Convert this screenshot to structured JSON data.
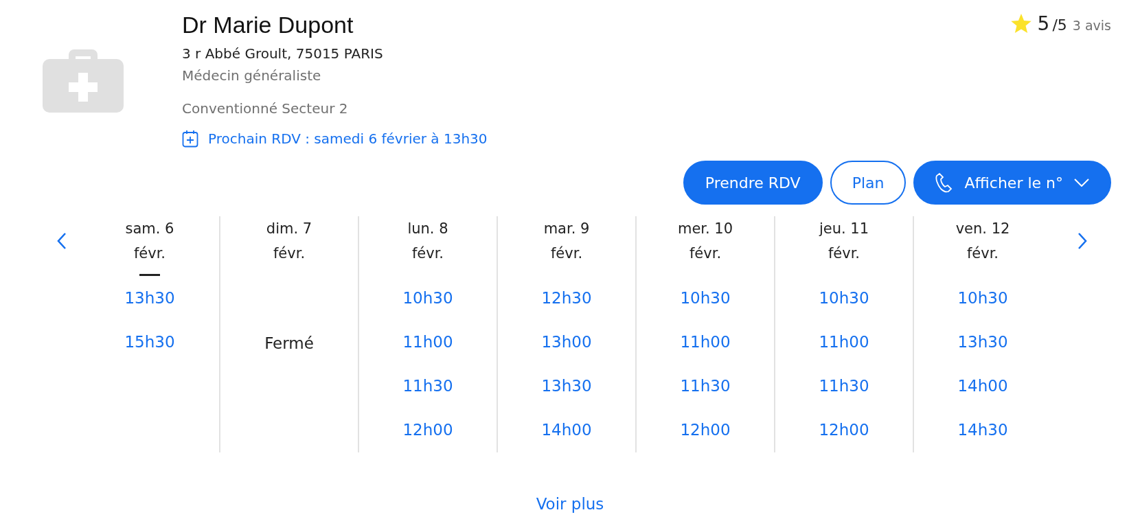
{
  "doctor": {
    "name": "Dr Marie Dupont",
    "address": "3 r Abbé Groult, 75015 PARIS",
    "specialty": "Médecin généraliste",
    "convention": "Conventionné Secteur 2",
    "next_appointment": "Prochain RDV : samedi 6 février à 13h30"
  },
  "rating": {
    "score": "5",
    "out_of": "/5",
    "reviews": "3 avis"
  },
  "buttons": [
    {
      "label": "Prendre RDV",
      "kind": "primary"
    },
    {
      "label": "Plan",
      "kind": "outline"
    },
    {
      "label": "Afficher le n°",
      "kind": "phone"
    }
  ],
  "calendar": {
    "days": [
      {
        "day": "sam. 6",
        "month": "févr.",
        "today": true,
        "kind": "slots",
        "slots": [
          "13h30",
          "15h30"
        ]
      },
      {
        "day": "dim. 7",
        "month": "févr.",
        "today": false,
        "kind": "closed",
        "note": "Fermé"
      },
      {
        "day": "lun. 8",
        "month": "févr.",
        "today": false,
        "kind": "slots",
        "slots": [
          "10h30",
          "11h00",
          "11h30",
          "12h00"
        ]
      },
      {
        "day": "mar. 9",
        "month": "févr.",
        "today": false,
        "kind": "slots",
        "slots": [
          "12h30",
          "13h00",
          "13h30",
          "14h00"
        ]
      },
      {
        "day": "mer. 10",
        "month": "févr.",
        "today": false,
        "kind": "slots",
        "slots": [
          "10h30",
          "11h00",
          "11h30",
          "12h00"
        ]
      },
      {
        "day": "jeu. 11",
        "month": "févr.",
        "today": false,
        "kind": "slots",
        "slots": [
          "10h30",
          "11h00",
          "11h30",
          "12h00"
        ]
      },
      {
        "day": "ven. 12",
        "month": "févr.",
        "today": false,
        "kind": "slots",
        "slots": [
          "10h30",
          "13h30",
          "14h00",
          "14h30"
        ]
      }
    ],
    "more": "Voir plus"
  }
}
